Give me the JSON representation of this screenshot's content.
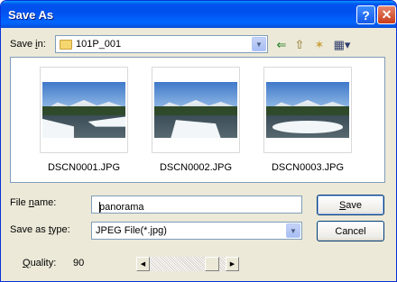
{
  "window": {
    "title": "Save As",
    "help_glyph": "?",
    "close_glyph": "✕"
  },
  "savein": {
    "label_prefix": "Save ",
    "label_accel": "i",
    "label_suffix": "n:",
    "value": "101P_001",
    "icon": "folder-icon"
  },
  "toolbar": {
    "back_glyph": "⇐",
    "up_glyph": "⇧",
    "newfolder_glyph": "✶",
    "views_glyph": "▦▾"
  },
  "files": [
    {
      "name": "DSCN0001.JPG"
    },
    {
      "name": "DSCN0002.JPG"
    },
    {
      "name": "DSCN0003.JPG"
    }
  ],
  "filename": {
    "label_prefix": "File ",
    "label_accel": "n",
    "label_suffix": "ame:",
    "value": "panorama"
  },
  "savetype": {
    "label_prefix": "Save as ",
    "label_accel": "t",
    "label_suffix": "ype:",
    "value": "JPEG File(*.jpg)"
  },
  "buttons": {
    "save_accel": "S",
    "save_rest": "ave",
    "cancel": "Cancel"
  },
  "quality": {
    "label_accel": "Q",
    "label_rest": "uality:",
    "value": "90",
    "level": 0.9
  },
  "colors": {
    "titlebar": "#0053ee",
    "dialog_bg": "#ece9d8",
    "field_border": "#7f9db9"
  }
}
